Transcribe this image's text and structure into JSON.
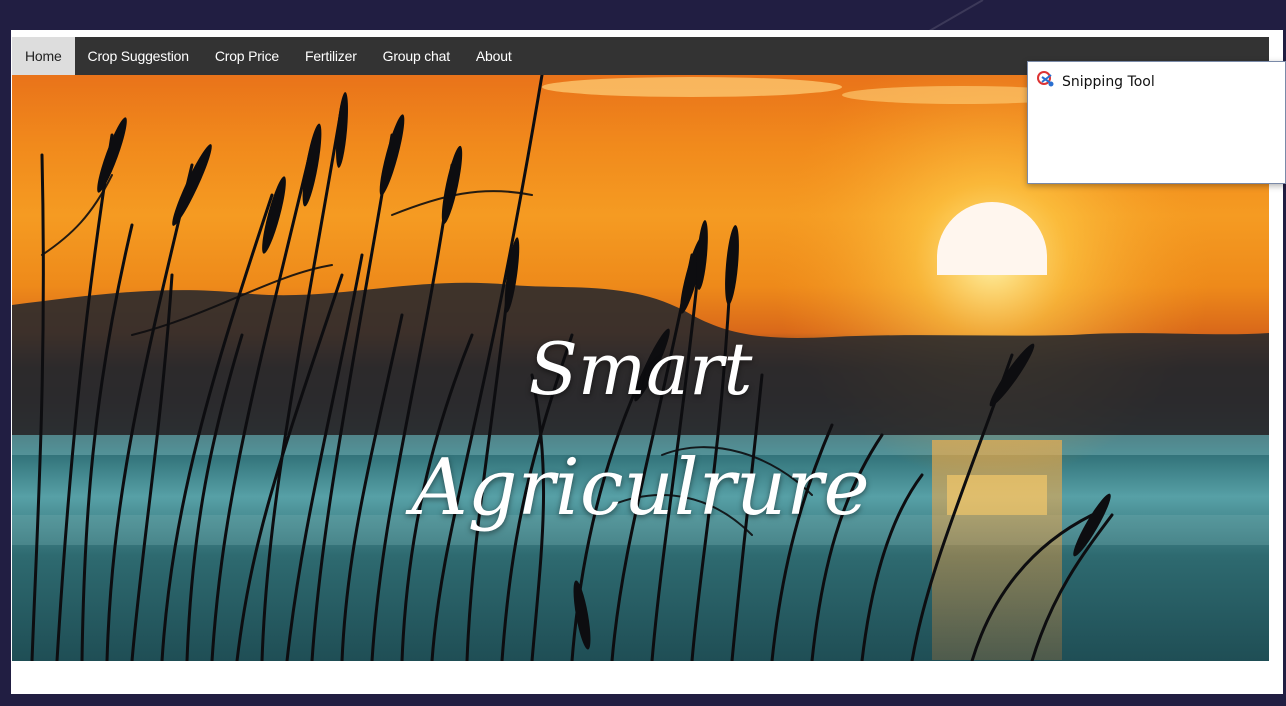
{
  "nav": {
    "items": [
      {
        "label": "Home",
        "active": true
      },
      {
        "label": "Crop Suggestion",
        "active": false
      },
      {
        "label": "Crop Price",
        "active": false
      },
      {
        "label": "Fertilizer",
        "active": false
      },
      {
        "label": "Group chat",
        "active": false
      },
      {
        "label": "About",
        "active": false
      }
    ]
  },
  "hero": {
    "title_line1": "Smart",
    "title_line2": "Agriculrure"
  },
  "popup": {
    "label": "Snipping Tool",
    "icon": "snipping-tool-icon"
  },
  "colors": {
    "nav_bg": "#333333",
    "nav_active_bg": "#dddddd",
    "desktop_bg": "#211e42"
  }
}
